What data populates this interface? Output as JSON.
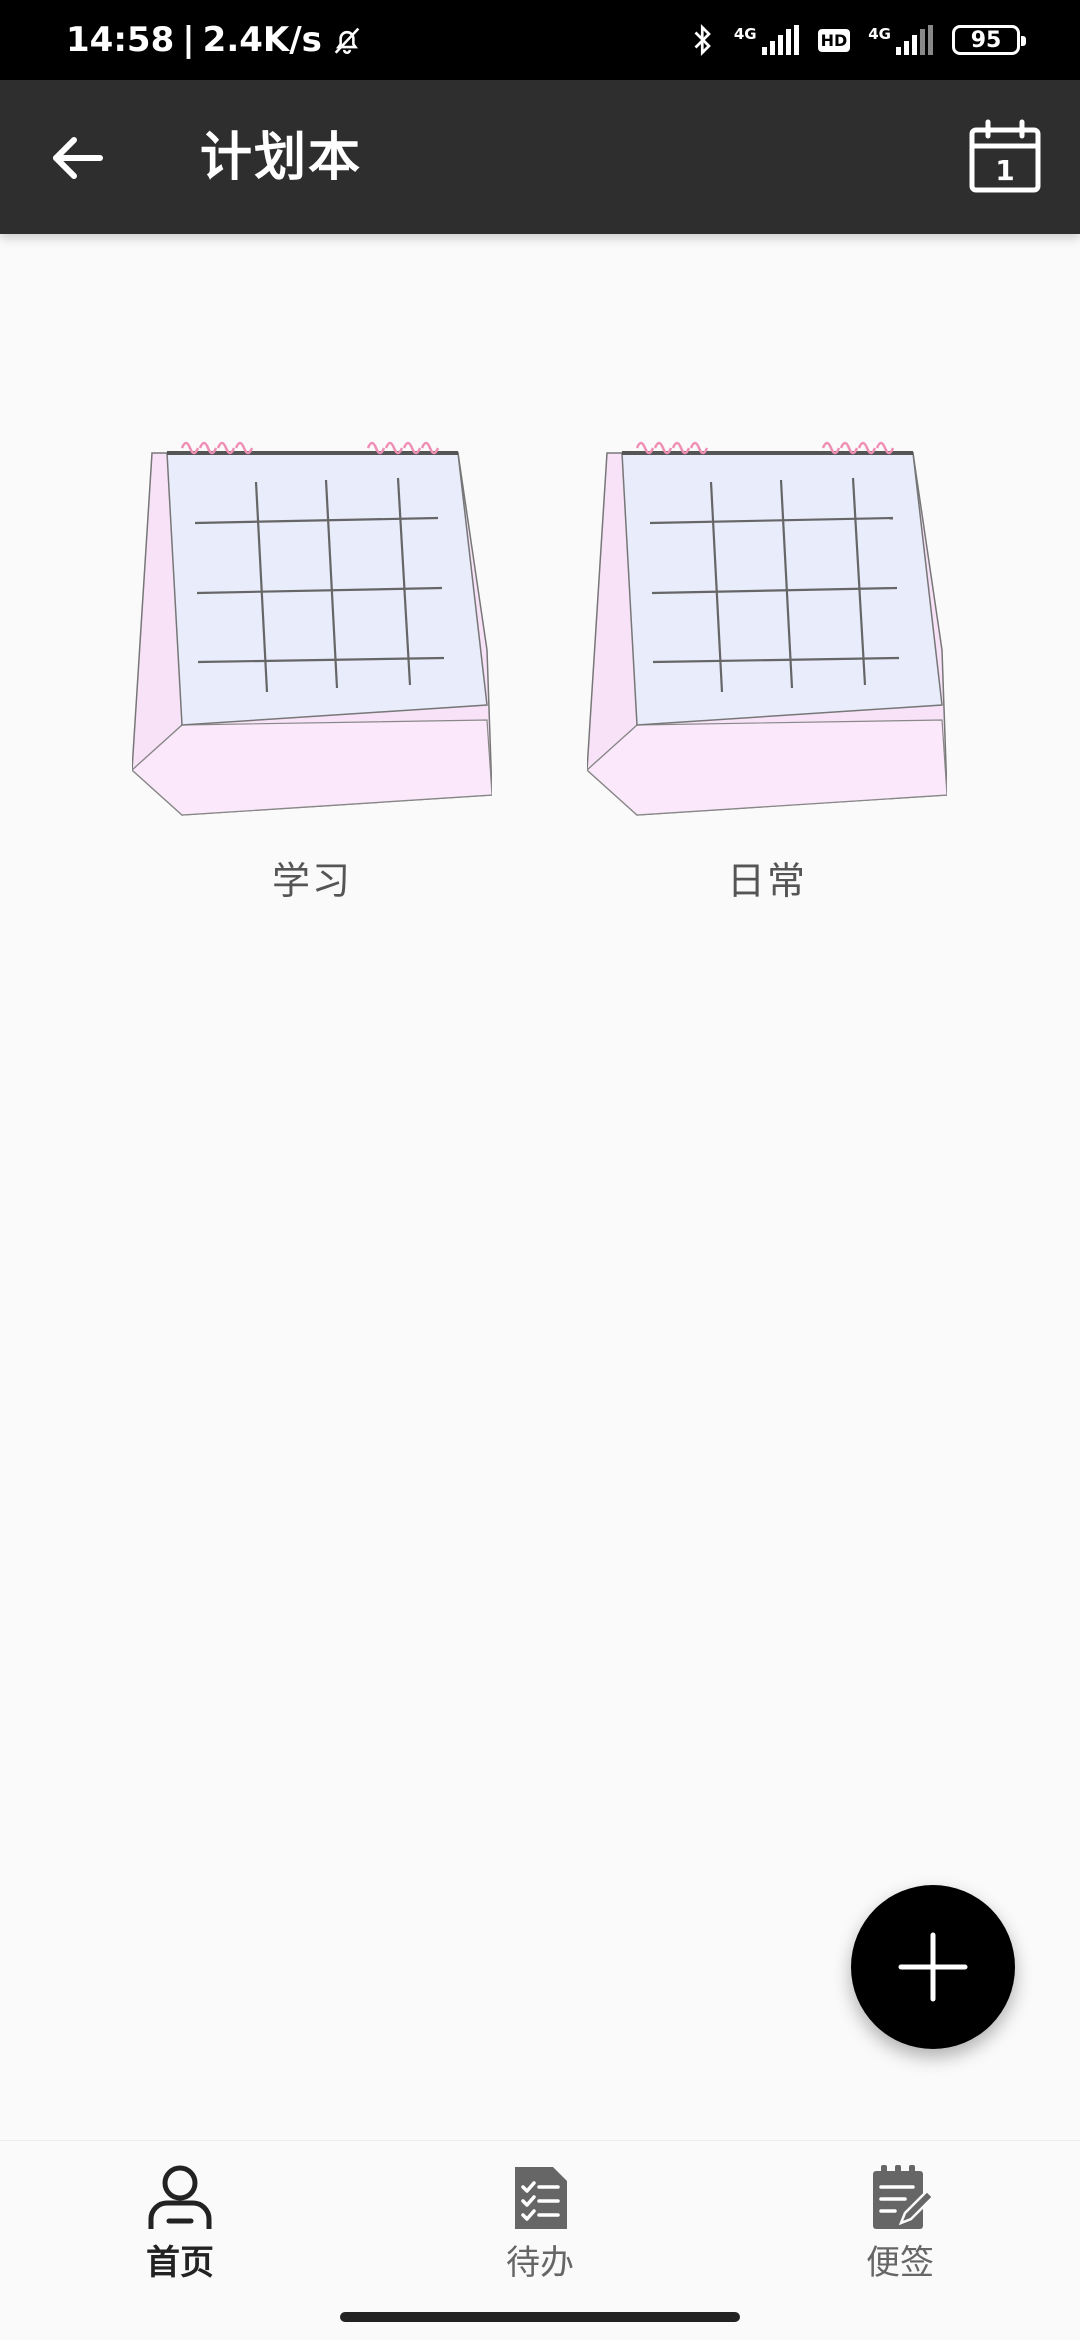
{
  "status_bar": {
    "time": "14:58",
    "separator": "|",
    "speed": "2.4K/s",
    "network_1": "4G",
    "hd_badge": "HD",
    "network_2": "4G",
    "battery": "95"
  },
  "app_bar": {
    "title": "计划本",
    "calendar_day": "1"
  },
  "planners": [
    {
      "label": "学习"
    },
    {
      "label": "日常"
    }
  ],
  "bottom_nav": {
    "items": [
      {
        "label": "首页",
        "icon": "person-icon",
        "active": true
      },
      {
        "label": "待办",
        "icon": "checklist-icon",
        "active": false
      },
      {
        "label": "便签",
        "icon": "note-edit-icon",
        "active": false
      }
    ]
  },
  "colors": {
    "app_bar_bg": "#2e2e2e",
    "page_bg": "#fafafa",
    "fab_bg": "#000000",
    "calendar_page": "#e8ecfb",
    "calendar_stand": "#f6def6",
    "calendar_rings": "#f08fb6"
  }
}
